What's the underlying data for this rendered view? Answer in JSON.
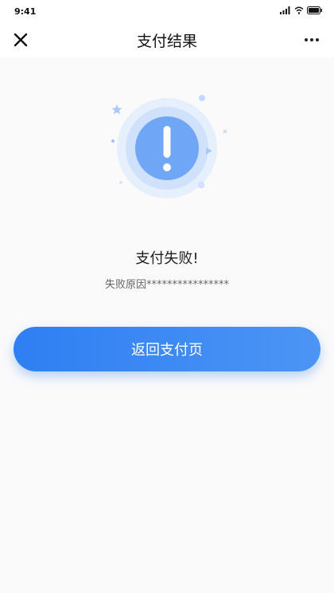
{
  "status_bar": {
    "time": "9:41",
    "icons": [
      "signal-icon",
      "wifi-icon",
      "battery-icon"
    ]
  },
  "nav": {
    "title": "支付结果",
    "close_icon": "close-icon",
    "more_icon": "more-icon"
  },
  "result": {
    "icon": "exclamation-icon",
    "title": "支付失败!",
    "reason": "失败原因****************"
  },
  "actions": {
    "return_label": "返回支付页"
  },
  "colors": {
    "accent": "#3482f5",
    "icon_circle": "#7bb0f8",
    "background": "#fafafa"
  }
}
